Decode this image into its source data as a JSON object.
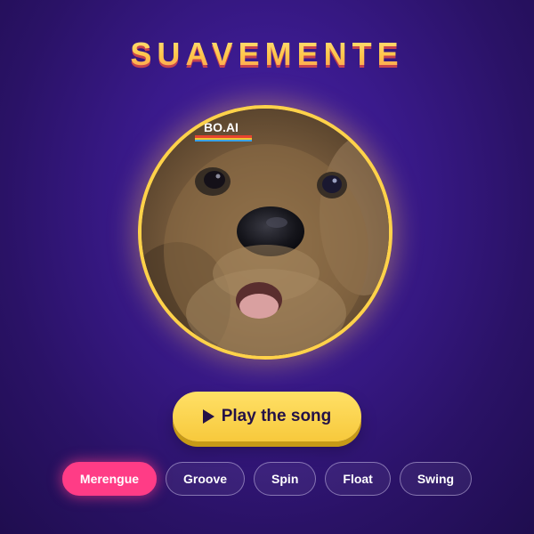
{
  "app": {
    "title": "SUAVEMENTE"
  },
  "portrait": {
    "watermark": "BO.AI",
    "icon": "quokka-photo"
  },
  "play_button": {
    "label": "Play the song",
    "icon": "play-icon"
  },
  "styles": {
    "items": [
      {
        "label": "Merengue",
        "active": true
      },
      {
        "label": "Groove",
        "active": false
      },
      {
        "label": "Spin",
        "active": false
      },
      {
        "label": "Float",
        "active": false
      },
      {
        "label": "Swing",
        "active": false
      }
    ]
  },
  "colors": {
    "background": "#2a1266",
    "accent_yellow": "#ffd24a",
    "accent_pink": "#ff3c86",
    "button_text": "#241147"
  }
}
